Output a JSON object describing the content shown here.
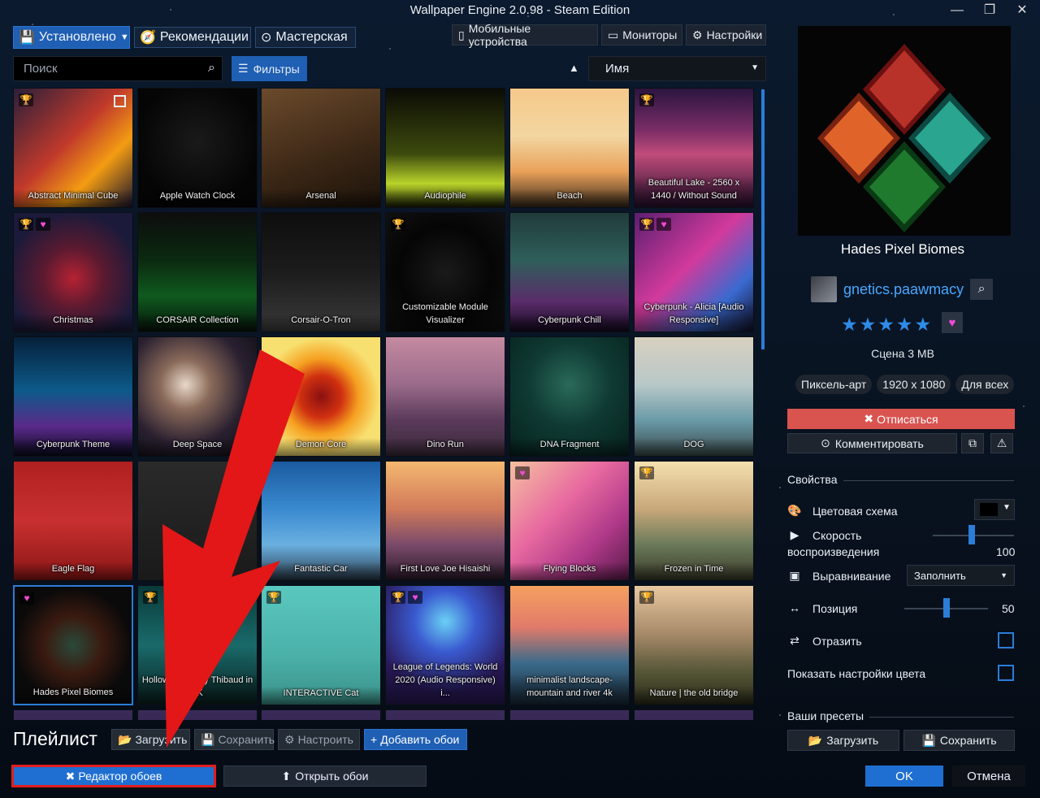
{
  "window": {
    "title": "Wallpaper Engine 2.0.98 - Steam Edition"
  },
  "tabs": {
    "installed": "Установлено",
    "recommendations": "Рекомендации",
    "workshop": "Мастерская"
  },
  "toolbar": {
    "mobile": "Мобильные устройства",
    "monitors": "Мониторы",
    "settings": "Настройки"
  },
  "search": {
    "placeholder": "Поиск"
  },
  "filters_label": "Фильтры",
  "sort": {
    "value": "Имя"
  },
  "wallpapers": [
    {
      "label": "Abstract Minimal Cube",
      "bg": "linear-gradient(135deg,#2a1f3a,#c0392b 45%,#f39c12 70%,#1b1530)",
      "badges": [
        "trophy-grey"
      ],
      "checkbox": true
    },
    {
      "label": "Apple Watch Clock",
      "bg": "radial-gradient(circle at 50% 45%,#1a1a1a 0,#050505 70%)",
      "badges": []
    },
    {
      "label": "Arsenal",
      "bg": "linear-gradient(160deg,#6b4a2c,#3a2615 60%,#1c130a)",
      "badges": []
    },
    {
      "label": "Audiophile",
      "bg": "linear-gradient(180deg,#0b0b05,#3c4a0d 55%,#b9d32a 80%,#1b2105)",
      "badges": []
    },
    {
      "label": "Beach",
      "bg": "linear-gradient(180deg,#f5c98a,#f3d6a1 40%,#e9a15a 70%,#3a2a1a)",
      "badges": []
    },
    {
      "label": "Beautiful Lake - 2560 x 1440 / Without Sound",
      "bg": "linear-gradient(180deg,#2b1540,#7a2d66 35%,#c04c7a 55%,#2a1030)",
      "badges": [
        "trophy"
      ]
    },
    {
      "label": "Christmas",
      "bg": "radial-gradient(circle at 50% 55%,#b52233 0,#5a1a30 35%,#1b1a3a 75%)",
      "badges": [
        "trophy",
        "heart"
      ]
    },
    {
      "label": "CORSAIR Collection",
      "bg": "linear-gradient(180deg,#0d0d0d,#0b2a10 40%,#0f5a1e 70%,#06140a)",
      "badges": []
    },
    {
      "label": "Corsair-O-Tron",
      "bg": "linear-gradient(180deg,#0e0e0e,#1c1c1c 50%,#3a3a3a)",
      "badges": []
    },
    {
      "label": "Customizable Module Visualizer",
      "bg": "radial-gradient(circle at 50% 50%,#1a1a1a 0,#050505 55%,#111 100%)",
      "badges": [
        "trophy"
      ]
    },
    {
      "label": "Cyberpunk Chill",
      "bg": "linear-gradient(180deg,#1f3b3a,#2f5e5a 40%,#5a2c6a 75%,#150a22)",
      "badges": []
    },
    {
      "label": "Cyberpunk - Alicia [Audio Responsive]",
      "bg": "linear-gradient(135deg,#5a1f70,#d23a9c 45%,#3a6ad0 75%,#12102a)",
      "badges": [
        "trophy",
        "heart"
      ]
    },
    {
      "label": "Cyberpunk Theme",
      "bg": "linear-gradient(180deg,#05203a,#0d5a8a 45%,#5a2a8a 75%,#0a0a20)",
      "badges": []
    },
    {
      "label": "Deep Space",
      "bg": "radial-gradient(circle at 40% 40%,#e8d8c8 0,#8a6a5a 25%,#2a2030 60%,#0a0a10 100%)",
      "badges": []
    },
    {
      "label": "Demon Core",
      "bg": "radial-gradient(circle at 50% 50%,#8a1010 0,#d03010 25%,#f5a020 45%,#f8e070 70%)",
      "badges": []
    },
    {
      "label": "Dino Run",
      "bg": "linear-gradient(180deg,#c58aa0,#9a6a8a 40%,#5a3a5a 70%,#3a2a3a)",
      "badges": []
    },
    {
      "label": "DNA Fragment",
      "bg": "radial-gradient(circle at 50% 40%,#2a6a5a 0,#0f3a33 45%,#06201c 100%)",
      "badges": []
    },
    {
      "label": "DOG",
      "bg": "linear-gradient(180deg,#d8d0c0,#b8c8c8 40%,#6a9aa8 70%,#3a4a4a)",
      "badges": []
    },
    {
      "label": "Eagle Flag",
      "bg": "linear-gradient(180deg,#b02020,#c83030 50%,#8a1515)",
      "badges": []
    },
    {
      "label": "",
      "bg": "linear-gradient(180deg,#2a2a2a,#1a1a1a)",
      "badges": []
    },
    {
      "label": "Fantastic Car",
      "bg": "linear-gradient(180deg,#1a5aa0,#3a8ad0 40%,#6ab0e0 70%,#2a3a4a)",
      "badges": []
    },
    {
      "label": "First Love Joe Hisaishi",
      "bg": "linear-gradient(180deg,#f5b870,#d07a5a 40%,#7a4a6a 70%,#2a1a2a)",
      "badges": []
    },
    {
      "label": "Flying Blocks",
      "bg": "linear-gradient(135deg,#f5c0a0,#e86aa0 40%,#b03a8a 70%,#5a1a4a)",
      "badges": [
        "heart"
      ]
    },
    {
      "label": "Frozen in Time",
      "bg": "linear-gradient(180deg,#f5e0b0,#c8a87a 40%,#6a7a5a 70%,#3a3a2a)",
      "badges": [
        "trophy"
      ]
    },
    {
      "label": "Hades Pixel Biomes",
      "bg": "radial-gradient(circle at 50% 50%,#2a4a3a 0,#3a1a10 35%,#0a0a0a 70%)",
      "badges": [
        "heart"
      ],
      "selected": true
    },
    {
      "label": "Hollow Knight by Thibaud in 4K",
      "bg": "linear-gradient(180deg,#0a3a3a,#1a6a6a 50%,#0a2020)",
      "badges": [
        "trophy"
      ]
    },
    {
      "label": "INTERACTIVE Cat",
      "bg": "linear-gradient(180deg,#5ac8c0,#4ab0a8 60%,#3a9088)",
      "badges": [
        "trophy"
      ]
    },
    {
      "label": "League of Legends: World 2020 (Audio Responsive) i...",
      "bg": "radial-gradient(circle at 50% 30%,#6ad0f5 0,#3a5ad0 30%,#2a1a5a 70%)",
      "badges": [
        "trophy",
        "heart"
      ]
    },
    {
      "label": "minimalist landscape-mountain and river 4k",
      "bg": "linear-gradient(180deg,#f5a060,#e07a6a 35%,#3a6a8a 65%,#1a2a3a)",
      "badges": []
    },
    {
      "label": "Nature | the old bridge",
      "bg": "linear-gradient(180deg,#e8c8a0,#a88a6a 40%,#5a5a3a 70%,#2a2a1a)",
      "badges": [
        "trophy"
      ]
    }
  ],
  "playlist": {
    "title": "Плейлист",
    "load": "Загрузить",
    "save": "Сохранить",
    "configure": "Настроить",
    "add": "Добавить обои"
  },
  "footer": {
    "editor": "Редактор обоев",
    "open": "Открыть обои",
    "ok": "OK",
    "cancel": "Отмена"
  },
  "details": {
    "title": "Hades Pixel Biomes",
    "author": "gnetics.paawmacy",
    "rating_stars": 5,
    "meta": "Сцена 3 MB",
    "tags": [
      "Пиксель-арт",
      "1920 x 1080",
      "Для всех"
    ],
    "unsubscribe": "Отписаться",
    "comment": "Комментировать"
  },
  "properties": {
    "header": "Свойства",
    "color_scheme": "Цветовая схема",
    "color_value": "#000000",
    "speed_label_1": "Скорость",
    "speed_label_2": "воспроизведения",
    "speed_value": "100",
    "align": "Выравнивание",
    "align_value": "Заполнить",
    "position": "Позиция",
    "position_value": "50",
    "mirror": "Отразить",
    "show_color": "Показать настройки цвета"
  },
  "presets": {
    "header": "Ваши пресеты",
    "load": "Загрузить",
    "save": "Сохранить"
  },
  "colors": {
    "accent": "#1f5fb4",
    "link": "#4aa7ff",
    "danger": "#d9534f",
    "highlight_red": "#e01e1e",
    "heart": "#f04bd6",
    "trophy": "#7fdc74"
  }
}
